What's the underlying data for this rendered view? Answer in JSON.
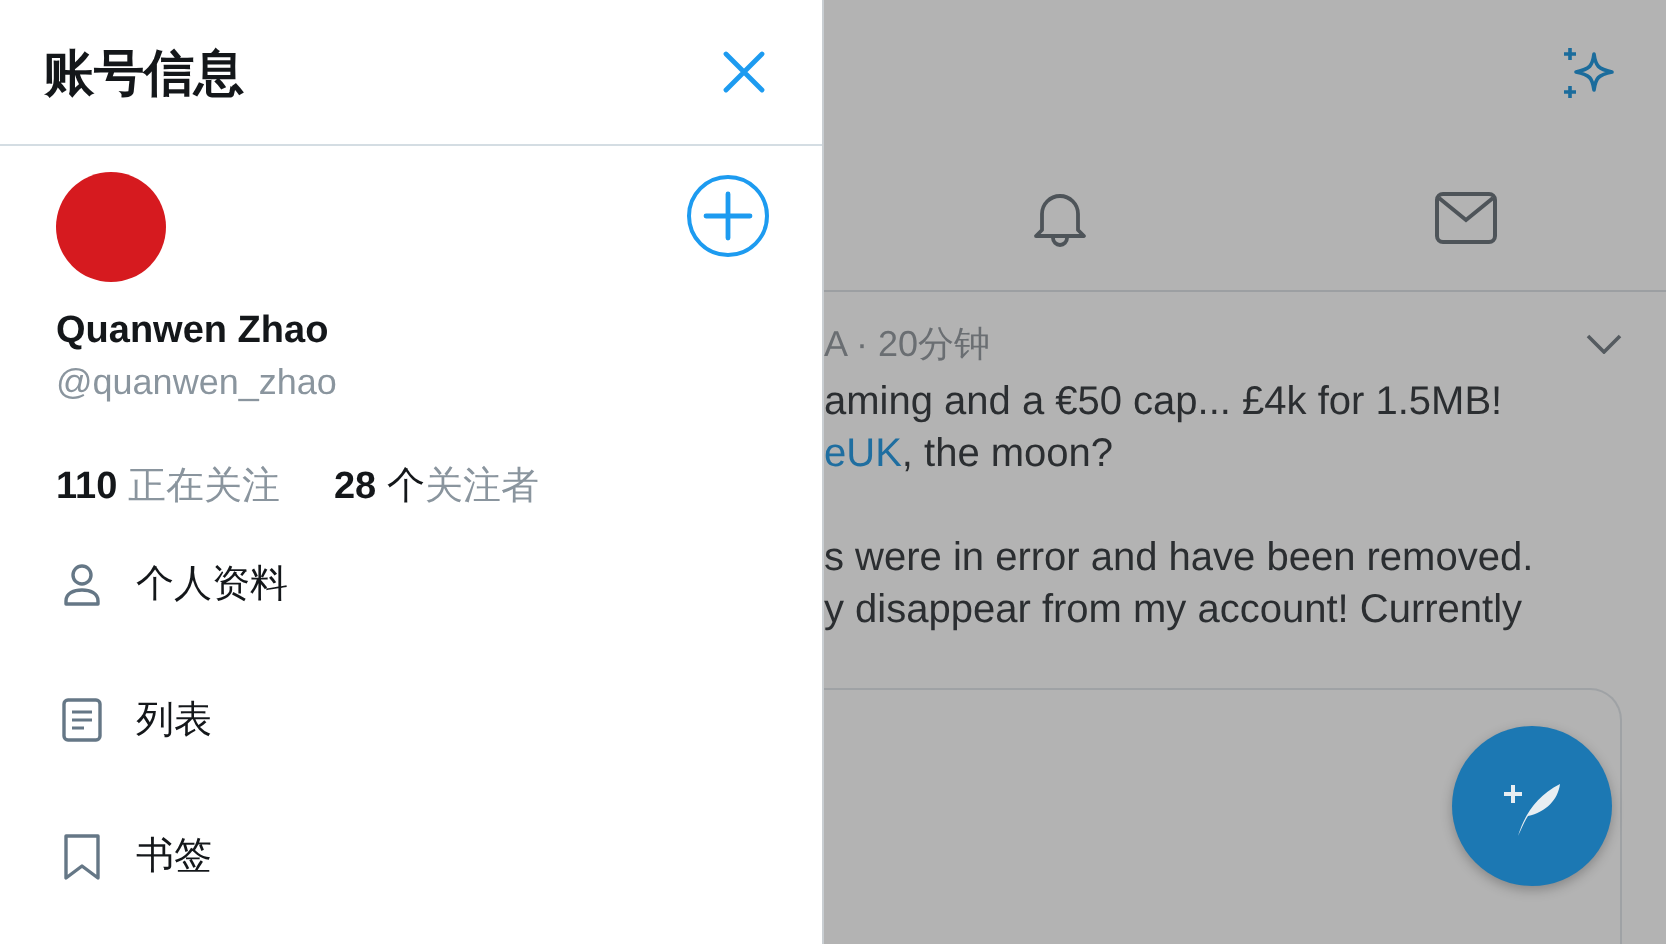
{
  "drawer": {
    "title": "账号信息",
    "profile": {
      "name": "Quanwen Zhao",
      "handle": "@quanwen_zhao"
    },
    "stats": [
      {
        "count": "110",
        "label": "正在关注"
      },
      {
        "count": "28",
        "unit": "个",
        "label": "关注者"
      }
    ],
    "menu": [
      {
        "kind": "person",
        "label": "个人资料"
      },
      {
        "kind": "list",
        "label": "列表"
      },
      {
        "kind": "bookmark",
        "label": "书签"
      }
    ]
  },
  "timeline": {
    "tabs": [
      {
        "kind": "bell"
      },
      {
        "kind": "mail"
      }
    ],
    "tweet": {
      "meta": "A · 20分钟",
      "paragraphs": [
        [
          {
            "text": "aming and a €50 cap... £4k for 1.5MB!"
          },
          {
            "link": "eUK",
            "text": ", the moon?"
          }
        ],
        [
          {
            "text": "s were in error and have been removed."
          },
          {
            "text": "y disappear from my account! Currently"
          }
        ]
      ]
    }
  }
}
